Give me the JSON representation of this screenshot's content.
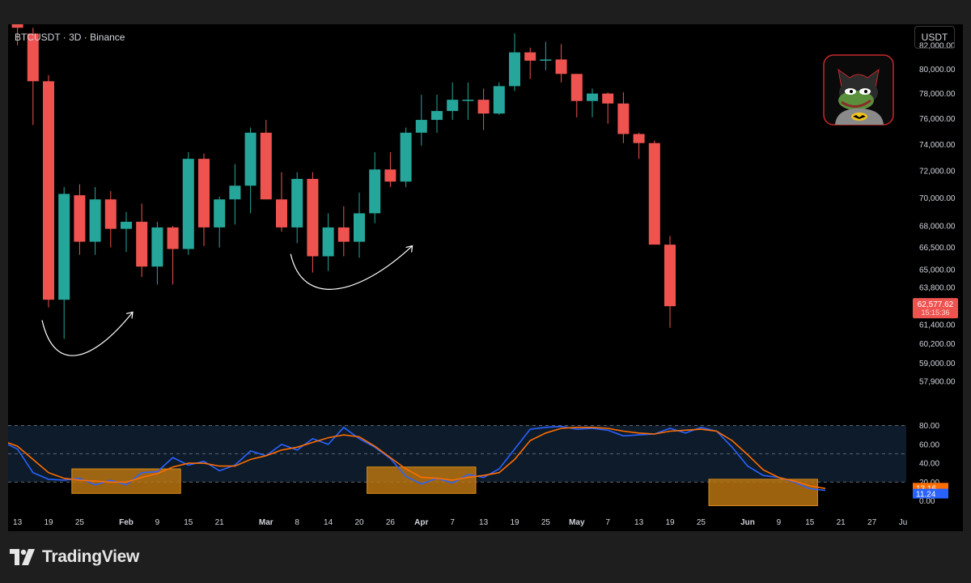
{
  "header": {
    "symbol": "BTCUSDT · 3D · Binance",
    "unit_button": "USDT"
  },
  "branding": {
    "name": "TradingView",
    "logo_icon": "tradingview-logo-icon"
  },
  "avatar_icon": "pepe-batman-avatar-icon",
  "colors": {
    "up": "#26a69a",
    "down": "#ef5350",
    "k_line": "#2962ff",
    "d_line": "#ff6d00",
    "highlight": "#b8730f",
    "background": "#000000"
  },
  "chart_data": [
    {
      "type": "candlestick",
      "title": "BTCUSDT · 3D · Binance",
      "y_scale": "log",
      "ylim": [
        56500,
        83800
      ],
      "y_ticks": [
        "82,000.00",
        "80,000.00",
        "78,000.00",
        "76,000.00",
        "74,000.00",
        "72,000.00",
        "70,000.00",
        "68,000.00",
        "66,500.00",
        "65,000.00",
        "63,800.00",
        "61,400.00",
        "60,200.00",
        "59,000.00",
        "57,900.00"
      ],
      "last_price": {
        "value": 62577.62,
        "label": "62,577.62",
        "countdown": "15:15:36"
      },
      "x_ticks": [
        {
          "label": "13",
          "i": 0
        },
        {
          "label": "19",
          "i": 2
        },
        {
          "label": "25",
          "i": 4
        },
        {
          "label": "Feb",
          "i": 7,
          "bold": true
        },
        {
          "label": "9",
          "i": 9
        },
        {
          "label": "15",
          "i": 11
        },
        {
          "label": "21",
          "i": 13
        },
        {
          "label": "Mar",
          "i": 16,
          "bold": true
        },
        {
          "label": "8",
          "i": 18
        },
        {
          "label": "14",
          "i": 20
        },
        {
          "label": "20",
          "i": 22
        },
        {
          "label": "26",
          "i": 24
        },
        {
          "label": "Apr",
          "i": 26,
          "bold": true
        },
        {
          "label": "7",
          "i": 28
        },
        {
          "label": "13",
          "i": 30
        },
        {
          "label": "19",
          "i": 32
        },
        {
          "label": "25",
          "i": 34
        },
        {
          "label": "May",
          "i": 36,
          "bold": true
        },
        {
          "label": "7",
          "i": 38
        },
        {
          "label": "13",
          "i": 40
        },
        {
          "label": "19",
          "i": 42
        },
        {
          "label": "25",
          "i": 44
        },
        {
          "label": "Jun",
          "i": 47,
          "bold": true
        },
        {
          "label": "9",
          "i": 49
        },
        {
          "label": "15",
          "i": 51
        },
        {
          "label": "21",
          "i": 53
        },
        {
          "label": "27",
          "i": 55
        },
        {
          "label": "Ju",
          "i": 57
        }
      ],
      "candles": [
        {
          "o": 84200,
          "h": 85000,
          "l": 82000,
          "c": 83500
        },
        {
          "o": 83000,
          "h": 83500,
          "l": 75500,
          "c": 79000
        },
        {
          "o": 79000,
          "h": 79500,
          "l": 62500,
          "c": 63000
        },
        {
          "o": 63000,
          "h": 70800,
          "l": 60500,
          "c": 70300
        },
        {
          "o": 70200,
          "h": 71000,
          "l": 66000,
          "c": 66900
        },
        {
          "o": 66900,
          "h": 70800,
          "l": 66000,
          "c": 69900
        },
        {
          "o": 69900,
          "h": 70500,
          "l": 66500,
          "c": 67800
        },
        {
          "o": 67800,
          "h": 69000,
          "l": 66200,
          "c": 68300
        },
        {
          "o": 68300,
          "h": 69600,
          "l": 64500,
          "c": 65200
        },
        {
          "o": 65200,
          "h": 68300,
          "l": 64000,
          "c": 67900
        },
        {
          "o": 67900,
          "h": 68000,
          "l": 64000,
          "c": 66400
        },
        {
          "o": 66400,
          "h": 73400,
          "l": 66000,
          "c": 72900
        },
        {
          "o": 72900,
          "h": 73300,
          "l": 66600,
          "c": 67900
        },
        {
          "o": 67900,
          "h": 70100,
          "l": 66500,
          "c": 69900
        },
        {
          "o": 69900,
          "h": 72500,
          "l": 68100,
          "c": 70900
        },
        {
          "o": 70900,
          "h": 75300,
          "l": 68900,
          "c": 74900
        },
        {
          "o": 74900,
          "h": 75900,
          "l": 69900,
          "c": 69900
        },
        {
          "o": 69900,
          "h": 71900,
          "l": 67600,
          "c": 67900
        },
        {
          "o": 67900,
          "h": 71900,
          "l": 66800,
          "c": 71400
        },
        {
          "o": 71400,
          "h": 71900,
          "l": 64800,
          "c": 65900
        },
        {
          "o": 65900,
          "h": 68900,
          "l": 64900,
          "c": 67900
        },
        {
          "o": 67900,
          "h": 69400,
          "l": 65900,
          "c": 66900
        },
        {
          "o": 66900,
          "h": 70400,
          "l": 65800,
          "c": 68900
        },
        {
          "o": 68900,
          "h": 73400,
          "l": 68200,
          "c": 72100
        },
        {
          "o": 72100,
          "h": 73400,
          "l": 70800,
          "c": 71200
        },
        {
          "o": 71200,
          "h": 75300,
          "l": 70800,
          "c": 74900
        },
        {
          "o": 74900,
          "h": 77900,
          "l": 73900,
          "c": 75900
        },
        {
          "o": 75900,
          "h": 77900,
          "l": 74900,
          "c": 76600
        },
        {
          "o": 76600,
          "h": 78900,
          "l": 75900,
          "c": 77500
        },
        {
          "o": 77500,
          "h": 78900,
          "l": 75900,
          "c": 77500
        },
        {
          "o": 77500,
          "h": 78400,
          "l": 75100,
          "c": 76400
        },
        {
          "o": 76400,
          "h": 78900,
          "l": 76300,
          "c": 78600
        },
        {
          "o": 78600,
          "h": 83000,
          "l": 78200,
          "c": 81400
        },
        {
          "o": 81400,
          "h": 81800,
          "l": 79200,
          "c": 80700
        },
        {
          "o": 80700,
          "h": 82300,
          "l": 79900,
          "c": 80800
        },
        {
          "o": 80800,
          "h": 82100,
          "l": 78900,
          "c": 79600
        },
        {
          "o": 79600,
          "h": 79600,
          "l": 76100,
          "c": 77400
        },
        {
          "o": 77400,
          "h": 78400,
          "l": 76100,
          "c": 78000
        },
        {
          "o": 78000,
          "h": 78100,
          "l": 75600,
          "c": 77200
        },
        {
          "o": 77200,
          "h": 78100,
          "l": 74100,
          "c": 74800
        },
        {
          "o": 74800,
          "h": 74900,
          "l": 72900,
          "c": 74100
        },
        {
          "o": 74100,
          "h": 74300,
          "l": 66700,
          "c": 66700
        },
        {
          "o": 66700,
          "h": 67300,
          "l": 61200,
          "c": 62578
        }
      ]
    },
    {
      "type": "line",
      "title": "Stochastic RSI",
      "ylim": [
        -8,
        95
      ],
      "y_ticks": [
        "80.00",
        "60.00",
        "40.00",
        "20.00",
        "0.00"
      ],
      "bands": [
        80,
        20
      ],
      "series": [
        {
          "values": [
            67,
            62,
            63,
            55,
            30,
            23,
            22,
            24,
            17,
            22,
            17,
            30,
            31,
            46,
            38,
            42,
            32,
            38,
            53,
            48,
            60,
            54,
            66,
            60,
            78,
            66,
            57,
            45,
            26,
            18,
            24,
            19,
            28,
            25,
            34,
            55,
            76,
            78,
            79,
            76,
            77,
            75,
            69,
            70,
            71,
            77,
            72,
            78,
            74,
            57,
            37,
            27,
            25,
            20,
            13,
            11.24
          ]
        },
        {
          "values": [
            70,
            66,
            64,
            58,
            44,
            30,
            24,
            22,
            21,
            20,
            20,
            25,
            29,
            36,
            40,
            40,
            37,
            37,
            44,
            48,
            54,
            57,
            62,
            67,
            70,
            68,
            58,
            46,
            34,
            25,
            24,
            22,
            25,
            27,
            30,
            44,
            64,
            72,
            77,
            78,
            78,
            77,
            74,
            72,
            71,
            74,
            75,
            76,
            74,
            64,
            49,
            33,
            25,
            21,
            16,
            13.16
          ]
        }
      ],
      "last_values": {
        "k": "11.24",
        "d": "13.16"
      },
      "highlight_boxes": [
        {
          "i0": 4,
          "i1": 10,
          "lo": 8,
          "hi": 34
        },
        {
          "i0": 23,
          "i1": 29,
          "lo": 8,
          "hi": 36
        },
        {
          "i0": 45,
          "i1": 51,
          "lo": -5,
          "hi": 23
        }
      ]
    }
  ],
  "annotations": [
    {
      "label": "rounded-bottom-arrow",
      "i0": 2,
      "i1": 7
    },
    {
      "label": "rounded-bottom-arrow",
      "i0": 18,
      "i1": 25
    },
    {
      "label": "rounded-bottom-arrow",
      "i0": 43,
      "i1": 49
    }
  ]
}
